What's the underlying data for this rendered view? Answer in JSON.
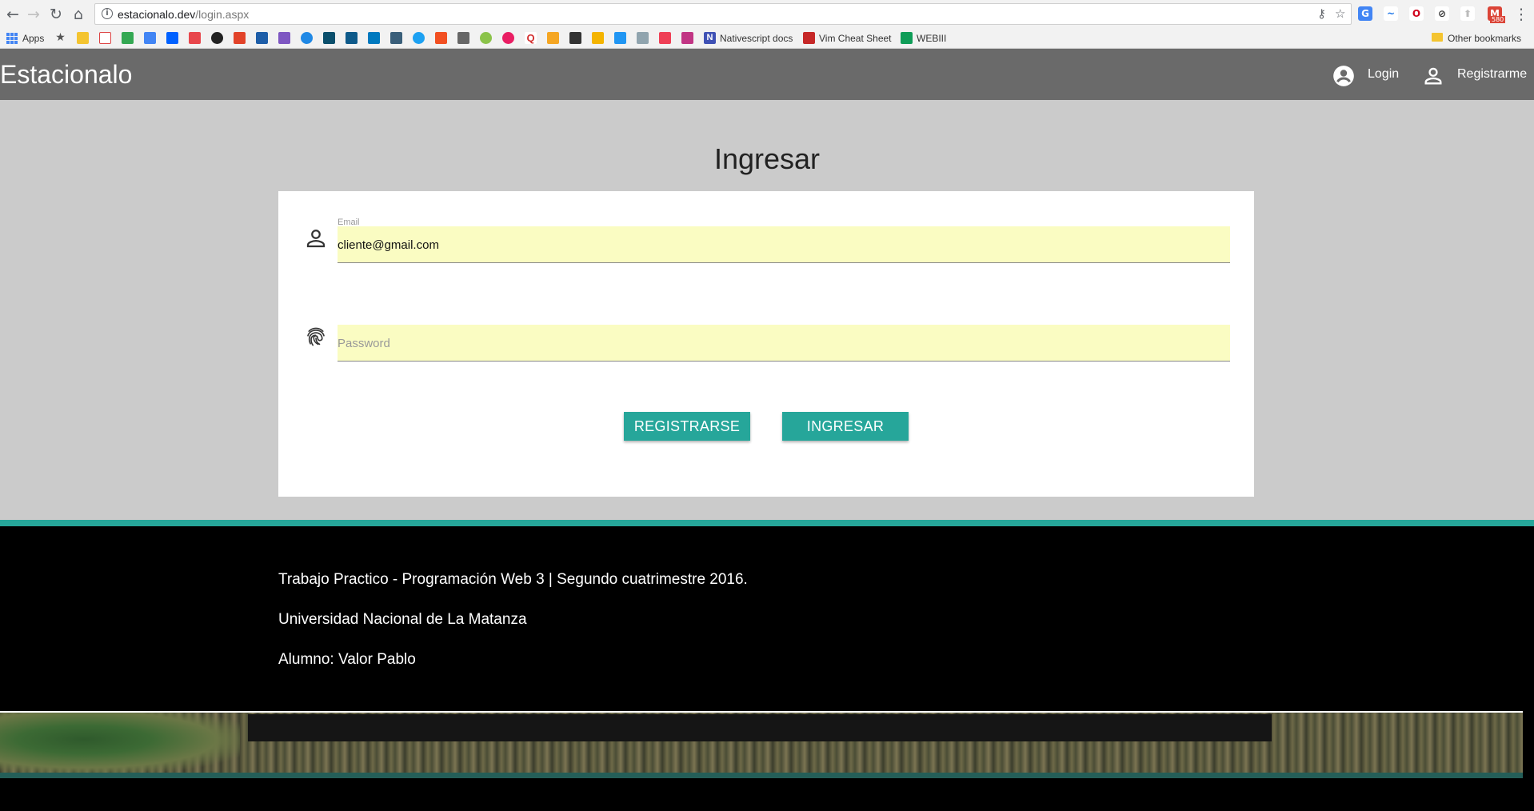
{
  "browser": {
    "url_host": "estacionalo.dev",
    "url_path": "/login.aspx",
    "bookmarks": [
      {
        "label": "Apps"
      },
      {
        "label": "Nativescript docs"
      },
      {
        "label": "Vim Cheat Sheet"
      },
      {
        "label": "WEBIII"
      },
      {
        "label": "Other bookmarks"
      }
    ],
    "gmail_badge": "580"
  },
  "appbar": {
    "brand": "Estacionalo",
    "login_label": "Login",
    "register_label": "Registrarme"
  },
  "login": {
    "title": "Ingresar",
    "email_label": "Email",
    "email_value": "cliente@gmail.com",
    "password_placeholder": "Password",
    "register_button": "REGISTRARSE",
    "submit_button": "INGRESAR"
  },
  "footer": {
    "line1": "Trabajo Practico - Programación Web 3 | Segundo cuatrimestre 2016.",
    "line2": "Universidad Nacional de La Matanza",
    "line3": "Alumno: Valor Pablo"
  },
  "colors": {
    "accent": "#26a69a",
    "appbar": "#6a6a6a",
    "main_bg": "#cbcbcb",
    "autofill": "#fafcc2"
  }
}
